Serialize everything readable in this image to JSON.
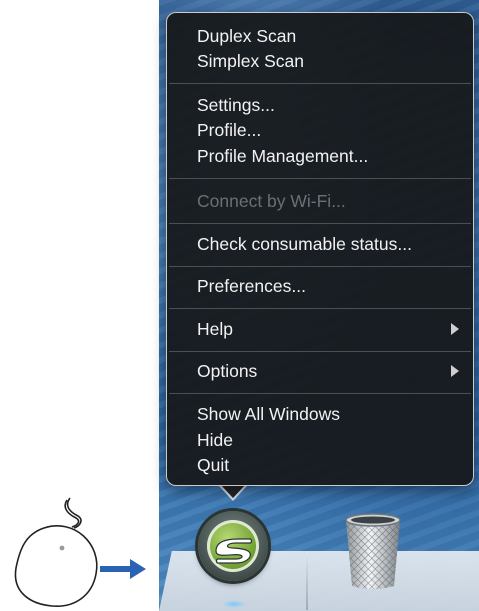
{
  "menu": {
    "groups": [
      {
        "items": [
          {
            "label": "Duplex Scan"
          },
          {
            "label": "Simplex Scan"
          }
        ]
      },
      {
        "items": [
          {
            "label": "Settings..."
          },
          {
            "label": "Profile..."
          },
          {
            "label": "Profile Management..."
          }
        ]
      },
      {
        "items": [
          {
            "label": "Connect by Wi-Fi...",
            "disabled": true
          }
        ]
      },
      {
        "items": [
          {
            "label": "Check consumable status..."
          }
        ]
      },
      {
        "items": [
          {
            "label": "Preferences..."
          }
        ]
      },
      {
        "items": [
          {
            "label": "Help",
            "submenu": true
          }
        ]
      },
      {
        "items": [
          {
            "label": "Options",
            "submenu": true
          }
        ]
      },
      {
        "items": [
          {
            "label": "Show All Windows"
          },
          {
            "label": "Hide"
          },
          {
            "label": "Quit"
          }
        ]
      }
    ]
  },
  "dock": {
    "apps": [
      {
        "name": "ScanSnap Manager",
        "icon": "scansnap-icon",
        "running": true
      },
      {
        "name": "Trash",
        "icon": "trash-icon"
      }
    ]
  },
  "illustration": {
    "mouse_icon": "mouse-icon",
    "arrow_icon": "right-arrow-icon",
    "arrow_color": "#2b63b4"
  },
  "colors": {
    "menu_background": "#16181b",
    "menu_text": "#f2f2f2",
    "menu_disabled_text": "#6c6f73",
    "scansnap_green": "#79a83a"
  }
}
